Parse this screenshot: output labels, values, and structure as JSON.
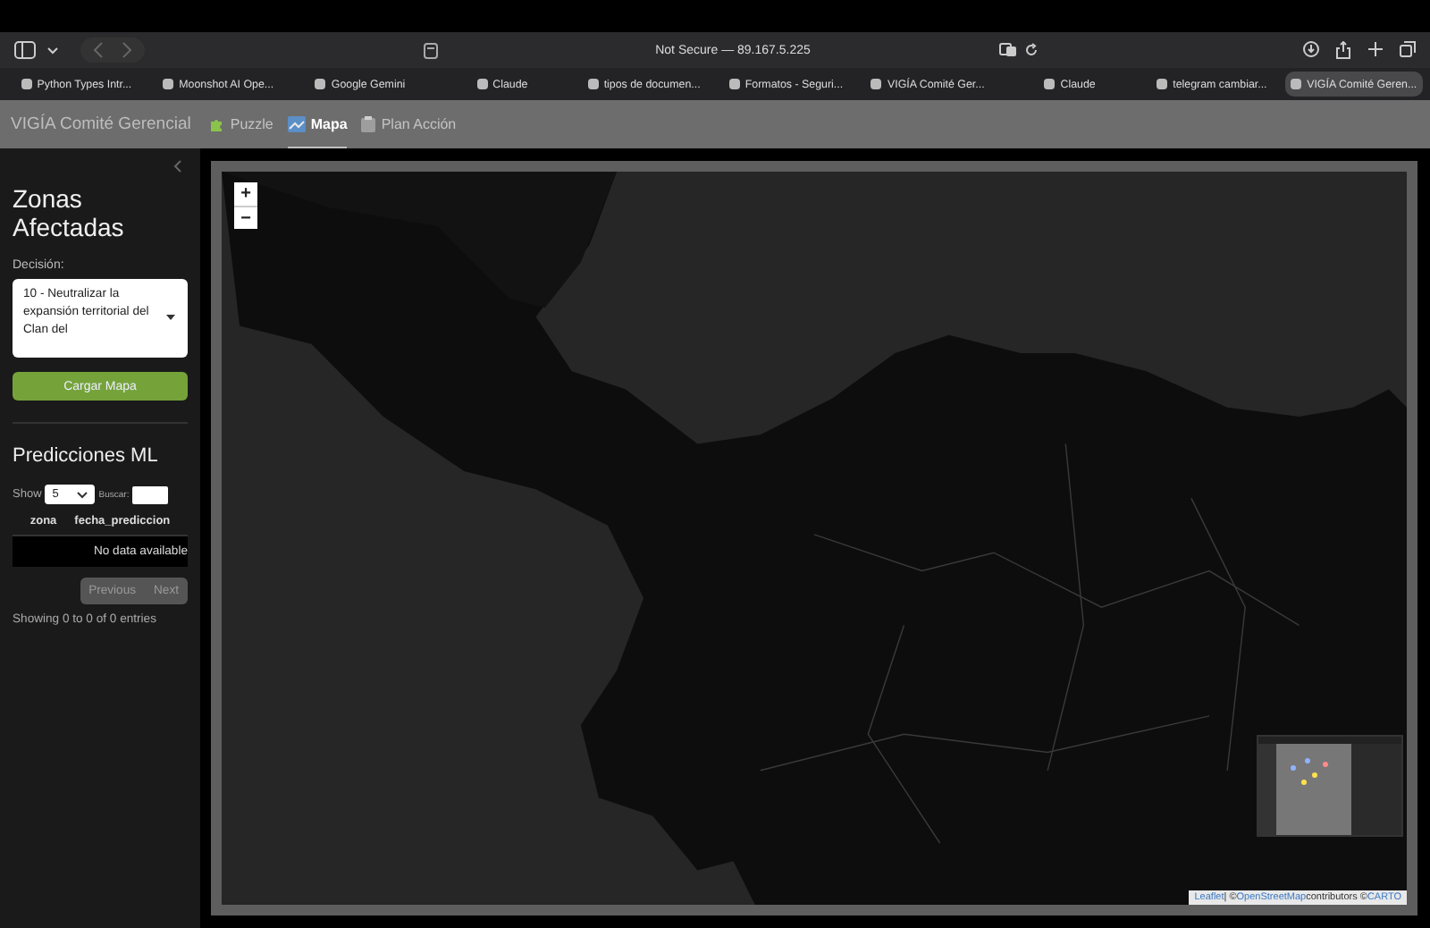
{
  "browser": {
    "address": "Not Secure — 89.167.5.225",
    "tabs": [
      {
        "title": "Python Types Intr...",
        "selected": false
      },
      {
        "title": "Moonshot AI Ope...",
        "selected": false
      },
      {
        "title": "Google Gemini",
        "selected": false
      },
      {
        "title": "Claude",
        "selected": false
      },
      {
        "title": "tipos de documen...",
        "selected": false
      },
      {
        "title": "Formatos - Seguri...",
        "selected": false
      },
      {
        "title": "VIGÍA Comité Ger...",
        "selected": false
      },
      {
        "title": "Claude",
        "selected": false
      },
      {
        "title": "telegram cambiar...",
        "selected": false
      },
      {
        "title": "VIGÍA Comité Geren...",
        "selected": true
      }
    ]
  },
  "app": {
    "brand": "VIGÍA Comité Gerencial",
    "nav": [
      {
        "label": "Puzzle",
        "selected": false
      },
      {
        "label": "Mapa",
        "selected": true
      },
      {
        "label": "Plan Acción",
        "selected": false
      }
    ]
  },
  "sidebar": {
    "title": "Zonas Afectadas",
    "decision_label": "Decisión:",
    "decision_value": "10 - Neutralizar la expansión territorial del Clan del",
    "load_button": "Cargar Mapa",
    "predictions": {
      "title": "Predicciones ML",
      "show_label": "Show",
      "page_size": "5",
      "search_label": "Buscar:",
      "columns": [
        "zona",
        "fecha_prediccion"
      ],
      "empty": "No data available",
      "info": "Showing 0 to 0 of 0 entries",
      "previous": "Previous",
      "next": "Next"
    }
  },
  "map": {
    "zoom_in": "+",
    "zoom_out": "−",
    "attribution": [
      {
        "text": "Leaflet",
        "link": true
      },
      {
        "text": " | © ",
        "link": false
      },
      {
        "text": "OpenStreetMap",
        "link": true
      },
      {
        "text": " contributors © ",
        "link": false
      },
      {
        "text": "CARTO",
        "link": true
      }
    ]
  }
}
